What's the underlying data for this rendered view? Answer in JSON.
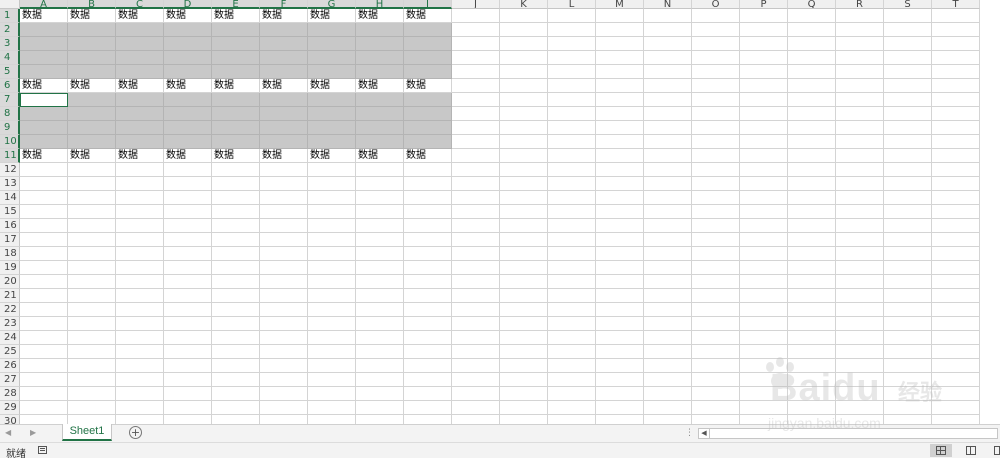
{
  "spreadsheet": {
    "columns": [
      "A",
      "B",
      "C",
      "D",
      "E",
      "F",
      "G",
      "H",
      "I",
      "J",
      "K",
      "L",
      "M",
      "N",
      "O",
      "P",
      "Q",
      "R",
      "S",
      "T"
    ],
    "selected_columns": [
      "A",
      "B",
      "C",
      "D",
      "E",
      "F",
      "G",
      "H",
      "I"
    ],
    "visible_row_count": 30,
    "selected_row_range": [
      1,
      11
    ],
    "data_rows": [
      1,
      6,
      11
    ],
    "gray_row_ranges": [
      [
        2,
        5
      ],
      [
        7,
        10
      ]
    ],
    "data_cell_text": "数据",
    "active_cell": "A7",
    "cell_fill_color": "#c8c8c8",
    "accent_color": "#217346"
  },
  "sheet_tabs": {
    "tabs": [
      "Sheet1"
    ],
    "active": "Sheet1",
    "add_label": "+"
  },
  "status_bar": {
    "status_text": "就绪",
    "view_modes": [
      "normal-view-icon",
      "page-layout-view-icon",
      "page-break-view-icon"
    ],
    "active_view": "normal-view-icon"
  },
  "watermark": {
    "brand": "Baidu",
    "service": "经验",
    "url": "jingyan.baidu.com"
  }
}
